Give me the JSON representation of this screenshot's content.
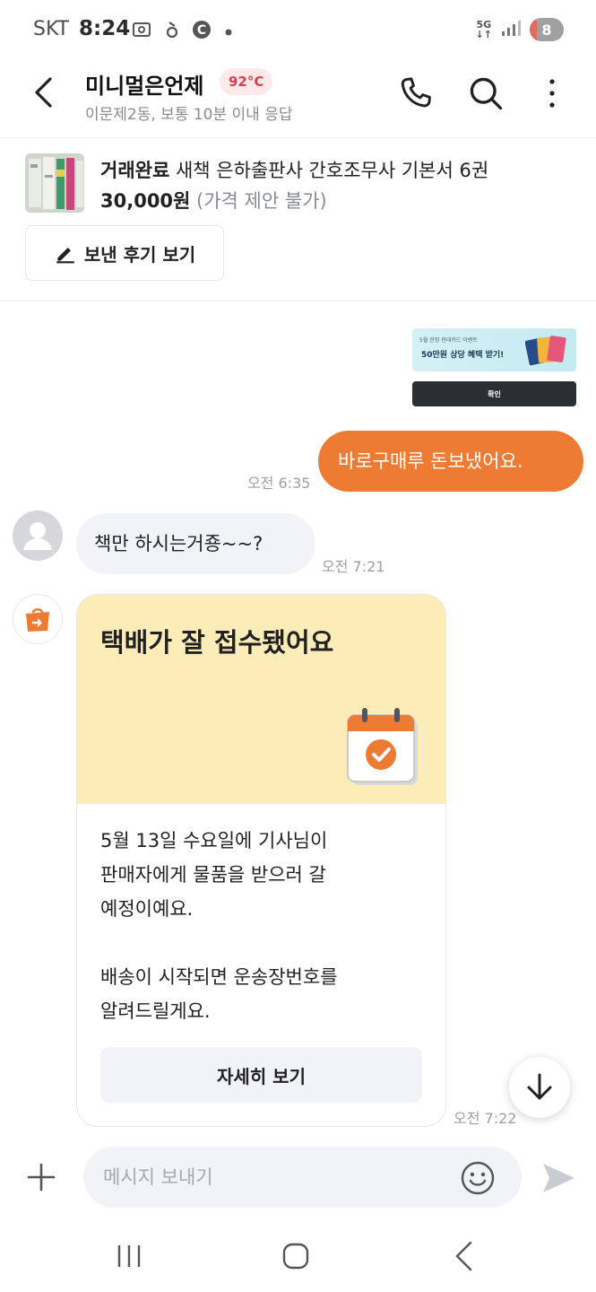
{
  "status_bar": {
    "carrier": "SKT",
    "time": "8:24",
    "network": "5G",
    "battery": "8"
  },
  "header": {
    "seller_name": "미니멀은언제",
    "manner_temp": "92°C",
    "subtitle": "이문제2동, 보통 10분 이내 응답"
  },
  "product": {
    "status": "거래완료",
    "title": "새책 은하출판사 간호조무사 기본서 6권",
    "price": "30,000원",
    "price_note": "(가격 제안 불가)",
    "review_button": "보낸 후기 보기"
  },
  "event_banner": {
    "small_text": "5월 한정 현대카드 이벤트",
    "main_text": "50만원 상당 혜택 받기!",
    "confirm_label": "확인"
  },
  "messages": {
    "outgoing": {
      "text": "바로구매루 돈보냈어요.",
      "time": "오전 6:35"
    },
    "incoming": {
      "text": "책만 하시는거죵~~?",
      "time": "오전 7:21"
    }
  },
  "delivery_card": {
    "title": "택배가 잘 접수됐어요",
    "body": "5월 13일 수요일에 기사님이\n판매자에게 물품을 받으러 갈\n예정이예요.\n\n배송이 시작되면 운송장번호를\n알려드릴게요.",
    "button": "자세히 보기",
    "time": "오전 7:22"
  },
  "composer": {
    "placeholder": "메시지 보내기"
  },
  "colors": {
    "accent": "#ee7b34",
    "temp_text": "#de3b4b",
    "card_header": "#fcecb7"
  },
  "icons": {
    "back": "chevron-left-icon",
    "call": "phone-icon",
    "search": "search-icon",
    "more": "more-vertical-icon",
    "review": "pencil-icon",
    "scroll": "arrow-down-icon",
    "add": "plus-icon",
    "emoji": "smiley-icon",
    "send": "send-icon"
  }
}
